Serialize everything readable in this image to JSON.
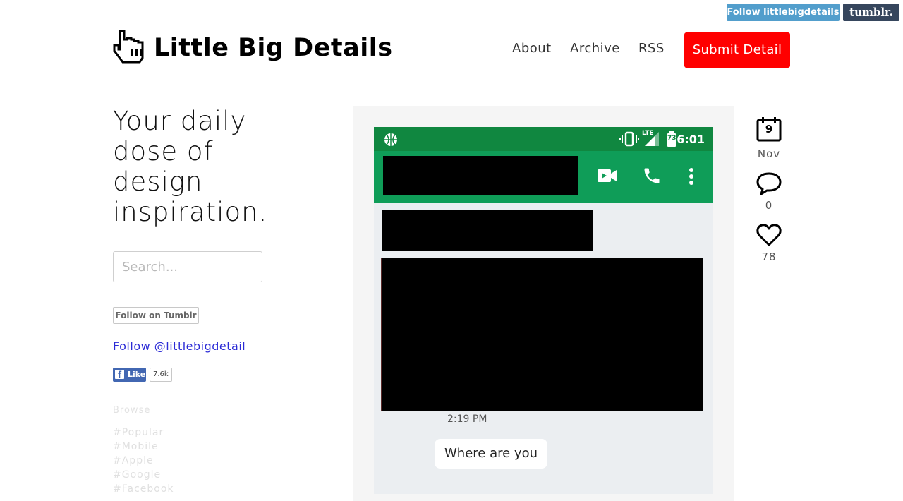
{
  "tumblr_bar": {
    "follow_label": "Follow littlebigdetails",
    "logo_text": "tumblr."
  },
  "header": {
    "title": "Little Big Details",
    "nav": {
      "about": "About",
      "archive": "Archive",
      "rss": "RSS"
    },
    "submit_label": "Submit Detail"
  },
  "sidebar": {
    "tagline": "Your daily dose of design inspiration.",
    "search_placeholder": "Search...",
    "follow_tumblr": "Follow on Tumblr",
    "follow_twitter": "Follow @littlebigdetail",
    "fb_like": "Like",
    "fb_count": "7.6k",
    "browse_label": "Browse",
    "browse_items": [
      "#Popular",
      "#Mobile",
      "#Apple",
      "#Google",
      "#Facebook"
    ]
  },
  "post": {
    "status_time": "6:01",
    "battery_level": "73",
    "lte": "LTE",
    "message_time": "2:19 PM",
    "message_text": "Where are you",
    "colors": {
      "status_bar": "#108740",
      "app_bar": "#0f9d58",
      "chat_bg": "#ebeef1"
    }
  },
  "meta": {
    "day": "9",
    "month": "Nov",
    "comments": "0",
    "likes": "78"
  },
  "colors": {
    "submit": "#ff0000",
    "tumblr_follow": "#529ecc",
    "tumblr_logo": "#36465d",
    "link": "#2b2bd6"
  }
}
